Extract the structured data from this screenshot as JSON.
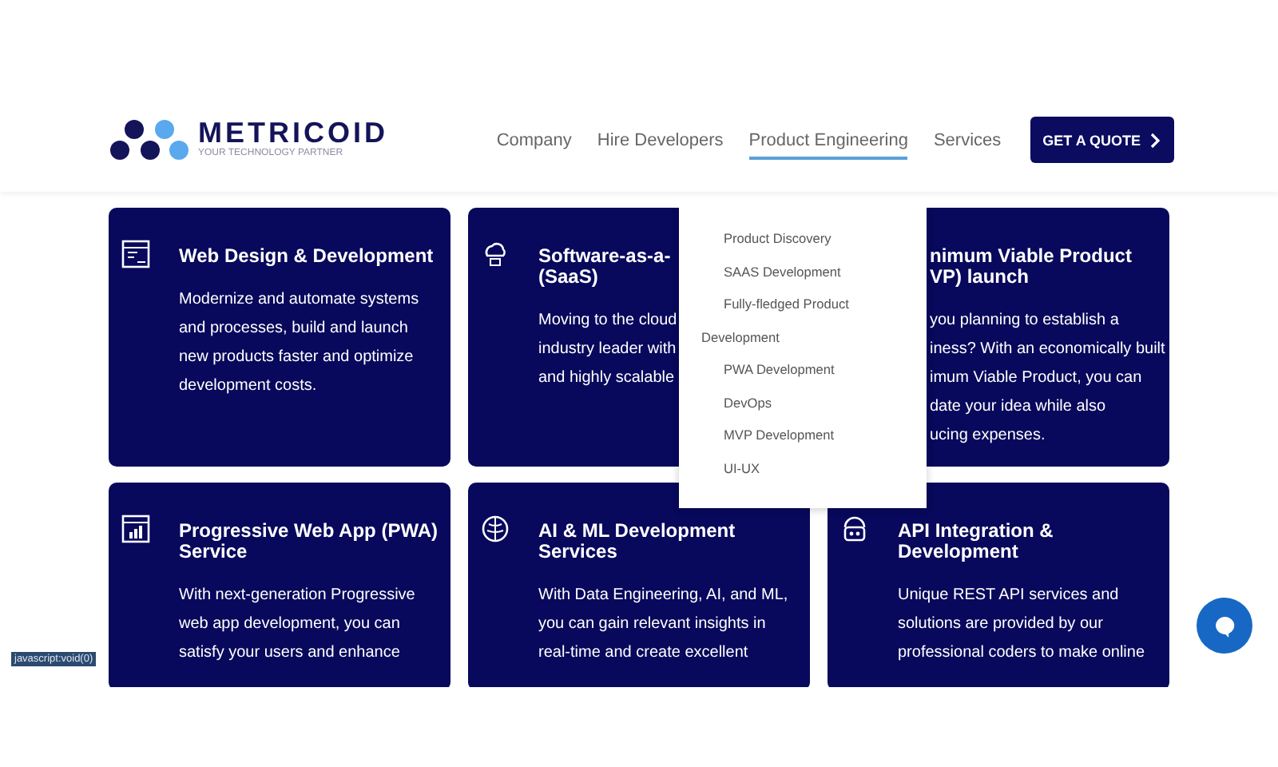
{
  "logo": {
    "name": "METRICOID",
    "tagline": "YOUR TECHNOLOGY PARTNER"
  },
  "nav": [
    {
      "label": "Company",
      "selected": false
    },
    {
      "label": "Hire Developers",
      "selected": false
    },
    {
      "label": "Product Engineering",
      "selected": true
    },
    {
      "label": "Services",
      "selected": false
    }
  ],
  "quote_button": "GET A QUOTE",
  "dropdown": [
    {
      "label": "Product Discovery",
      "kind": "item"
    },
    {
      "label": "SAAS Development",
      "kind": "item"
    },
    {
      "label": "Fully-fledged Product",
      "kind": "item"
    },
    {
      "label": "Development",
      "kind": "wrap"
    },
    {
      "label": "PWA Development",
      "kind": "item"
    },
    {
      "label": "DevOps",
      "kind": "item"
    },
    {
      "label": "MVP Development",
      "kind": "item"
    },
    {
      "label": "UI-UX",
      "kind": "item"
    }
  ],
  "cards": [
    {
      "title": [
        "Web Design & Development"
      ],
      "text": [
        "Modernize and automate systems",
        "and processes, build and launch",
        "new products faster and optimize",
        "development costs."
      ]
    },
    {
      "title": [
        "Software-as-a-",
        "(SaaS)"
      ],
      "text": [
        "Moving to the cloud",
        "industry leader with",
        "and highly scalable"
      ]
    },
    {
      "title": [
        "nimum Viable Product",
        "VP) launch"
      ],
      "text": [
        "you planning to establish a",
        "iness? With an economically built",
        "imum Viable Product, you can",
        "date your idea while also",
        "ucing expenses."
      ]
    },
    {
      "title": [
        "Progressive Web App (PWA)",
        "Service"
      ],
      "text": [
        "With next-generation Progressive",
        "web app development, you can",
        "satisfy your users and enhance"
      ]
    },
    {
      "title": [
        "AI & ML Development",
        "Services"
      ],
      "text": [
        "With Data Engineering, AI, and ML,",
        "you can gain relevant insights in",
        "real-time and create excellent"
      ]
    },
    {
      "title": [
        "API Integration &",
        "Development"
      ],
      "text": [
        "Unique REST API services and",
        "solutions are provided by our",
        "professional coders to make online"
      ]
    }
  ],
  "status_link": "javascript:void(0)"
}
